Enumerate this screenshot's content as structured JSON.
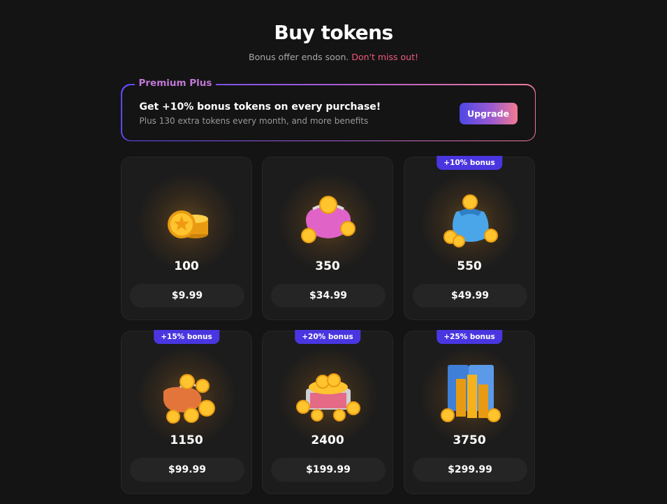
{
  "header": {
    "title": "Buy tokens",
    "subtitle": "Bonus offer ends soon.",
    "subtitle_highlight": "Don't miss out!"
  },
  "premium": {
    "label": "Premium Plus",
    "headline": "Get +10% bonus tokens on every purchase!",
    "description": "Plus 130 extra tokens every month, and more benefits",
    "button_label": "Upgrade"
  },
  "packs": [
    {
      "amount": "100",
      "price": "$9.99",
      "badge": "",
      "icon": "coin-stack-icon"
    },
    {
      "amount": "350",
      "price": "$34.99",
      "badge": "",
      "icon": "coin-purse-icon"
    },
    {
      "amount": "550",
      "price": "$49.99",
      "badge": "+10% bonus",
      "icon": "coin-bag-icon"
    },
    {
      "amount": "1150",
      "price": "$99.99",
      "badge": "+15% bonus",
      "icon": "coin-sack-icon"
    },
    {
      "amount": "2400",
      "price": "$199.99",
      "badge": "+20% bonus",
      "icon": "coin-chest-icon"
    },
    {
      "amount": "3750",
      "price": "$299.99",
      "badge": "+25% bonus",
      "icon": "coin-vault-icon"
    }
  ],
  "colors": {
    "background": "#141414",
    "card": "#1c1c1c",
    "accent": "#4a36e0",
    "highlight": "#f05a7e",
    "gold": "#f5b21c"
  }
}
